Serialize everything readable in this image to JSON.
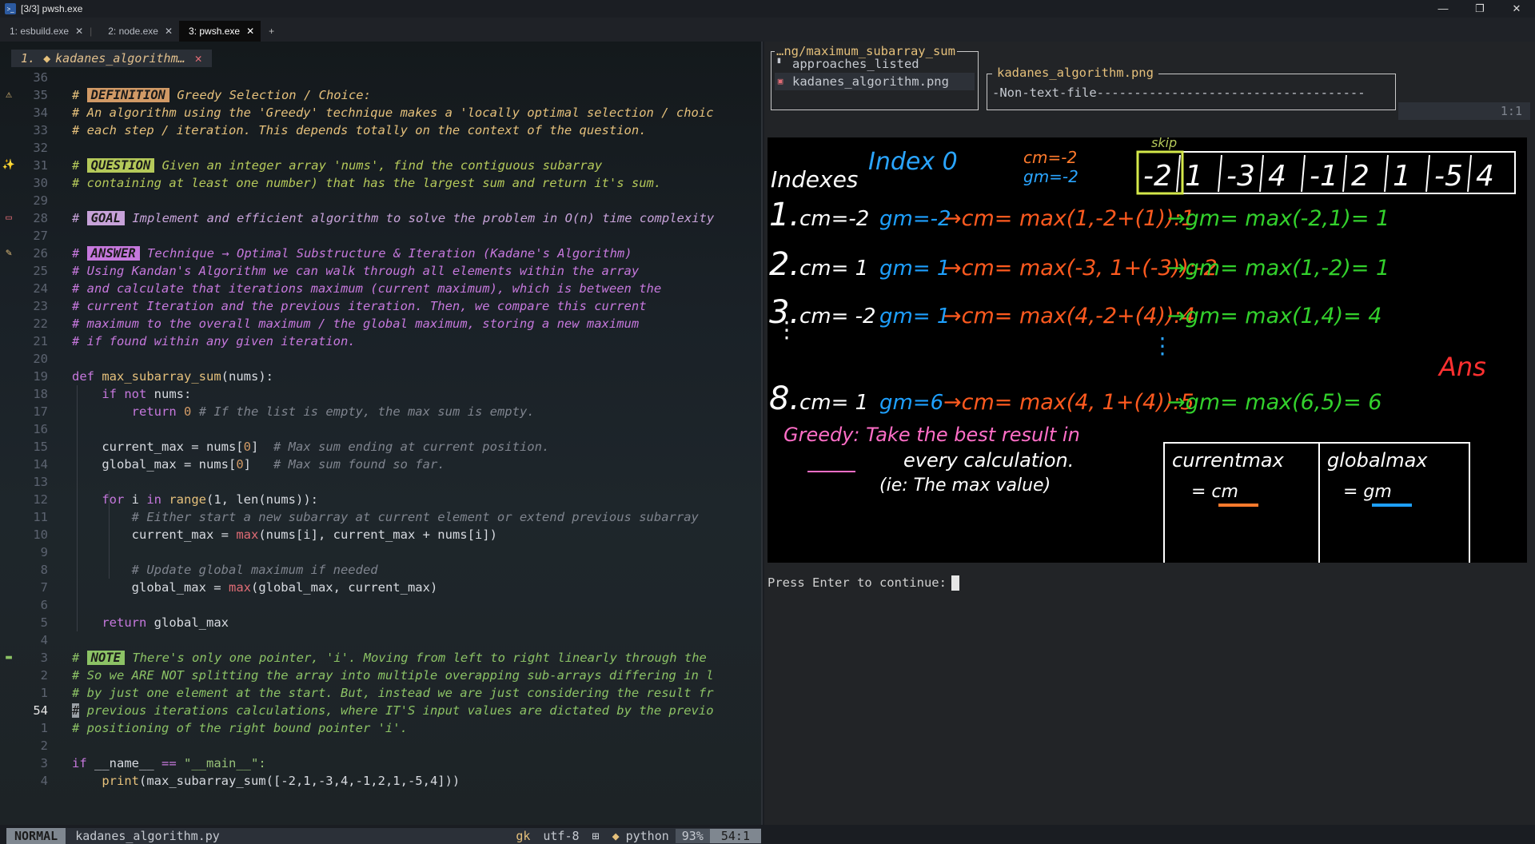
{
  "window": {
    "title": "[3/3] pwsh.exe",
    "icon": "terminal-icon"
  },
  "tabs": [
    {
      "label": "1: esbuild.exe"
    },
    {
      "label": "2: node.exe"
    },
    {
      "label": "3: pwsh.exe",
      "active": true
    }
  ],
  "buffer": {
    "index": "1.",
    "name": "kadanes_algorithm…"
  },
  "code_lines": [
    {
      "n": "36",
      "t": ""
    },
    {
      "n": "35",
      "tag": "DEFINITION",
      "tagc": "tagD",
      "t": " Greedy Selection / Choice:",
      "c": "cd",
      "g": "⚠",
      "gc": "#e5c07b"
    },
    {
      "n": "34",
      "t": "# An algorithm using the 'Greedy' technique makes a 'locally optimal selection / choic",
      "c": "cd"
    },
    {
      "n": "33",
      "t": "# each step / iteration. This depends totally on the context of the question.",
      "c": "cd"
    },
    {
      "n": "32",
      "t": ""
    },
    {
      "n": "31",
      "tag": "QUESTION",
      "tagc": "tagQ",
      "t": " Given an integer array 'nums', find the contiguous subarray",
      "c": "cq",
      "g": "✨",
      "gc": "#e5c07b"
    },
    {
      "n": "30",
      "t": "# containing at least one number) that has the largest sum and return it's sum.",
      "c": "cq"
    },
    {
      "n": "29",
      "t": ""
    },
    {
      "n": "28",
      "tag": "GOAL",
      "tagc": "tagG",
      "t": " Implement and efficient algorithm to solve the problem in O(n) time complexity",
      "c": "cg",
      "g": "▭",
      "gc": "#e06c75"
    },
    {
      "n": "27",
      "t": ""
    },
    {
      "n": "26",
      "tag": "ANSWER",
      "tagc": "tagA",
      "t": " Technique → Optimal Substructure & Iteration (Kadane's Algorithm)",
      "c": "ca",
      "g": "✎",
      "gc": "#e5c07b"
    },
    {
      "n": "25",
      "t": "# Using Kandan's Algorithm we can walk through all elements within the array",
      "c": "ca"
    },
    {
      "n": "24",
      "t": "# and calculate that iterations maximum (current maximum), which is between the",
      "c": "ca"
    },
    {
      "n": "23",
      "t": "# current Iteration and the previous iteration. Then, we compare this current",
      "c": "ca"
    },
    {
      "n": "22",
      "t": "# maximum to the overall maximum / the global maximum, storing a new maximum",
      "c": "ca"
    },
    {
      "n": "21",
      "t": "# if found within any given iteration.",
      "c": "ca"
    },
    {
      "n": "20",
      "t": ""
    },
    {
      "n": "19",
      "code": "def"
    },
    {
      "n": "18",
      "code": "ifnot"
    },
    {
      "n": "17",
      "code": "ret0"
    },
    {
      "n": "16",
      "t": ""
    },
    {
      "n": "15",
      "code": "cur"
    },
    {
      "n": "14",
      "code": "glob"
    },
    {
      "n": "13",
      "t": ""
    },
    {
      "n": "12",
      "code": "for"
    },
    {
      "n": "11",
      "code": "c1"
    },
    {
      "n": "10",
      "code": "cmax"
    },
    {
      "n": "9",
      "t": ""
    },
    {
      "n": "8",
      "code": "c2"
    },
    {
      "n": "7",
      "code": "gmax"
    },
    {
      "n": "6",
      "t": ""
    },
    {
      "n": "5",
      "code": "ret"
    },
    {
      "n": "4",
      "t": ""
    },
    {
      "n": "3",
      "tag": "NOTE",
      "tagc": "tagN",
      "t": " There's only one pointer, 'i'. Moving from left to right linearly through the",
      "c": "cn",
      "g": "▬",
      "gc": "#8cc265"
    },
    {
      "n": "2",
      "t": "# So we ARE NOT splitting the array into multiple overapping sub-arrays differing in l",
      "c": "cn"
    },
    {
      "n": "1",
      "t": "# by just one element at the start. But, instead we are just considering the result fr",
      "c": "cn"
    },
    {
      "n": "54",
      "t": "previous iterations calculations, where IT'S input values are dictated by the previo",
      "c": "cn",
      "cur": true
    },
    {
      "n": "1",
      "t": "# positioning of the right bound pointer 'i'.",
      "c": "cn"
    },
    {
      "n": "2",
      "t": ""
    },
    {
      "n": "3",
      "code": "main"
    },
    {
      "n": "4",
      "code": "print"
    }
  ],
  "code_text": {
    "def_kw": "def",
    "def_fn": "max_subarray_sum",
    "def_arg": "(nums):",
    "if": "if",
    "not": "not",
    "nums_colon": " nums:",
    "return": "return",
    "zero": "0",
    "ret0_cm": "# If the list is empty, the max sum is empty.",
    "cur_var": "current_max = nums[",
    "cur_idx": "0",
    "cur_end": "]",
    "cur_cm": "# Max sum ending at current position.",
    "glob_var": "global_max = nums[",
    "glob_cm": "# Max sum found so far.",
    "for": "for",
    "for_mid": " i ",
    "in": "in",
    "range": "range",
    "for_args": "(1, len(nums)):",
    "c1": "# Either start a new subarray at current element or extend previous subarray",
    "cmax_var": "current_max = ",
    "max": "max",
    "cmax_args": "(nums[i], current_max + nums[i])",
    "c2": "# Update global maximum if needed",
    "gmax_var": "global_max = ",
    "gmax_args": "(global_max, current_max)",
    "ret_var": " global_max",
    "main_if": "if",
    "main_mid": " __name__ ",
    "eq": "==",
    "main_str": " \"__main__\":",
    "print": "print",
    "print_args": "(max_subarray_sum([-2,1,-3,4,-1,2,1,-5,4]))"
  },
  "status": {
    "mode": "NORMAL",
    "file": "kadanes_algorithm.py",
    "branch": "gk",
    "encoding": "utf-8",
    "os_icon": "windows-icon",
    "filetype": "python",
    "percent": "93%",
    "position": "54:1"
  },
  "file_browser": {
    "title": "…ng/maximum_subarray_sum",
    "items": [
      {
        "name": "approaches_listed",
        "icon": "file-icon"
      },
      {
        "name": "kadanes_algorithm.png",
        "icon": "image-icon",
        "selected": true
      }
    ]
  },
  "preview": {
    "title": "kadanes_algorithm.png",
    "body": "-Non-text-file------------------------------------"
  },
  "ruler": "1:1",
  "image": {
    "row_index": "Indexes",
    "index0": "Index 0",
    "cm_init": "cm=-2",
    "gm_init": "gm=-2",
    "skip": "skip",
    "array": [
      "-2",
      "1",
      "-3",
      "4",
      "-1",
      "2",
      "1",
      "-5",
      "4"
    ],
    "rows": [
      {
        "n": "1.",
        "cm": "cm=-2",
        "gm": "gm=-2",
        "calc": "→cm= max(1,-2+(1)):1",
        "g": "→gm= max(-2,1)= 1"
      },
      {
        "n": "2.",
        "cm": "cm= 1",
        "gm": "gm= 1",
        "calc": "→cm= max(-3, 1+(-3)):-2",
        "g": "→gm= max(1,-2)= 1"
      },
      {
        "n": "3.",
        "cm": "cm= -2",
        "gm": "gm= 1",
        "calc": "→cm= max(4,-2+(4)):4",
        "g": "→gm= max(1,4)= 4"
      },
      {
        "n": "8.",
        "cm": "cm= 1",
        "gm": "gm=6",
        "calc": "→cm= max(4, 1+(4)):5",
        "g": "→gm= max(6,5)= 6"
      }
    ],
    "ans": "Ans",
    "greedy1": "Greedy: Take the best result in",
    "greedy2": "every calculation.",
    "greedy3": "(ie: The max value)",
    "tbl_h1": "currentmax",
    "tbl_h2": "globalmax",
    "tbl_v1": "= cm",
    "tbl_v2": "= gm"
  },
  "prompt": "Press Enter to continue:",
  "colors": {
    "cm": "#ff5a1f",
    "gm": "#1ea0ff",
    "yellow": "#ffe100",
    "green": "#33d12c",
    "purple": "#b55cff",
    "orange": "#ff7a2c",
    "red": "#ff3030",
    "pink": "#ff6ec7"
  }
}
